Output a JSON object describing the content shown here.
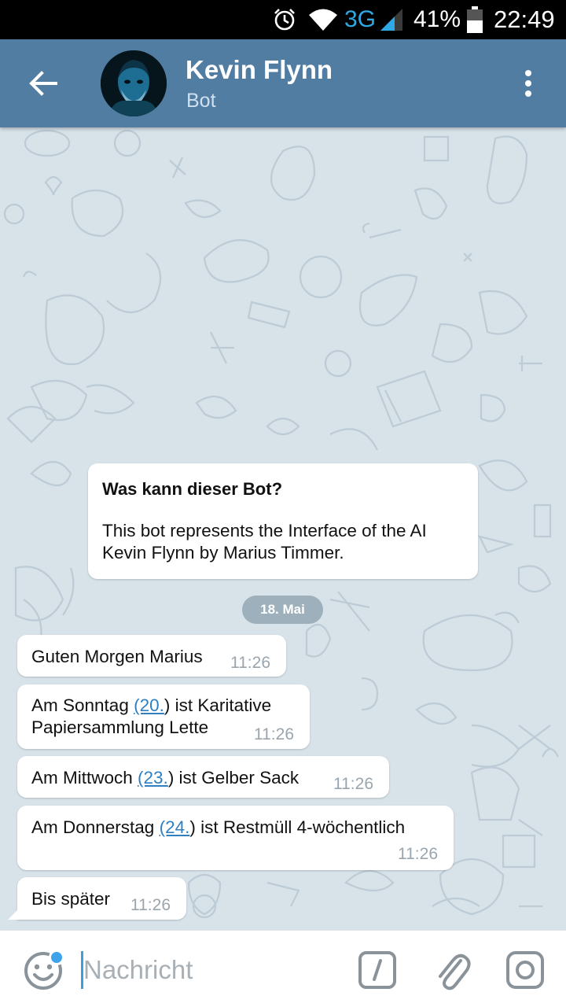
{
  "status_bar": {
    "network": "3G",
    "battery_percent": "41%",
    "time": "22:49",
    "icons": [
      "alarm-clock-icon",
      "wifi-icon",
      "signal-icon",
      "battery-icon"
    ]
  },
  "header": {
    "name": "Kevin Flynn",
    "subtitle": "Bot",
    "colors": {
      "bar": "#527da3"
    }
  },
  "bot_info": {
    "title": "Was kann dieser Bot?",
    "body": "This bot represents the Interface of the AI Kevin Flynn by Marius Timmer."
  },
  "date_separator": "18. Mai",
  "messages": [
    {
      "parts": [
        "Guten Morgen Marius"
      ],
      "time": "11:26"
    },
    {
      "parts": [
        "Am Sonntag ",
        "(20.",
        ") ist Karitative",
        "Papiersammlung Lette"
      ],
      "time": "11:26"
    },
    {
      "parts": [
        "Am Mittwoch ",
        "(23.",
        ") ist Gelber Sack"
      ],
      "time": "11:26"
    },
    {
      "parts": [
        "Am Donnerstag ",
        "(24.",
        ") ist Restmüll 4-wöchentlich"
      ],
      "time": "11:26"
    },
    {
      "parts": [
        "Bis später"
      ],
      "time": "11:26"
    }
  ],
  "input": {
    "placeholder": "Nachricht"
  }
}
